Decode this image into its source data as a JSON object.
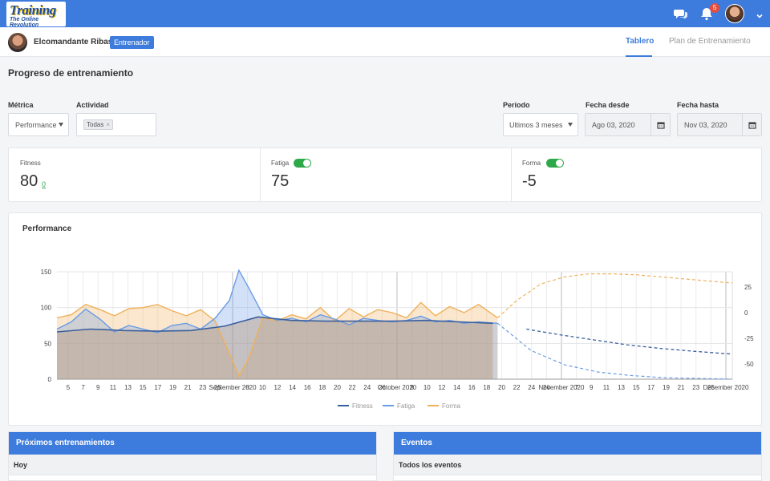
{
  "topbar": {
    "logo_line1": "Training",
    "logo_line2": "The Online Revolution",
    "notifications_count": "5"
  },
  "subbar": {
    "user_name": "Elcomandante Ribas",
    "role": "Entrenador",
    "tabs": [
      {
        "label": "Tablero",
        "active": true
      },
      {
        "label": "Plan de Entrenamiento",
        "active": false
      }
    ]
  },
  "page": {
    "title": "Progreso de entrenamiento"
  },
  "filters": {
    "metric": {
      "label": "Métrica",
      "value": "Performance"
    },
    "activity": {
      "label": "Actividad",
      "tag": "Todas",
      "tag_remove": "×"
    },
    "period": {
      "label": "Período",
      "value": "Ultimos 3 meses"
    },
    "date_from": {
      "label": "Fecha desde",
      "value": "Ago 03, 2020"
    },
    "date_to": {
      "label": "Fecha hasta",
      "value": "Nov 03, 2020"
    }
  },
  "summary": {
    "fitness": {
      "label": "Fitness",
      "value": "80",
      "delta": "0"
    },
    "fatigue": {
      "label": "Fatiga",
      "value": "75",
      "toggle_on": true
    },
    "form": {
      "label": "Forma",
      "value": "-5",
      "toggle_on": true
    }
  },
  "chart_data": {
    "type": "line",
    "title": "Performance",
    "x_range": [
      "2020-08-03",
      "2020-12-22"
    ],
    "ylim_left": [
      0,
      150
    ],
    "yticks_left": [
      0,
      50,
      100,
      150
    ],
    "ylim_right": [
      -65,
      40
    ],
    "yticks_right": [
      -50,
      -25,
      0,
      25
    ],
    "xticks": [
      "5",
      "7",
      "9",
      "11",
      "13",
      "15",
      "17",
      "19",
      "21",
      "23",
      "25",
      "September 2020",
      "8",
      "10",
      "12",
      "14",
      "16",
      "18",
      "20",
      "22",
      "24",
      "26",
      "October 2020",
      "8",
      "10",
      "12",
      "14",
      "16",
      "18",
      "20",
      "22",
      "24",
      "26",
      "November 2020",
      "7",
      "9",
      "11",
      "13",
      "15",
      "17",
      "19",
      "21",
      "23",
      "25",
      "December 2020"
    ],
    "grid": true,
    "legend_position": "bottom",
    "colors": {
      "fitness": "#3a5f9e",
      "fatigue": "#6b9be6",
      "form": "#f0b05a"
    },
    "series": [
      {
        "name": "Fitness",
        "axis": "left",
        "x": [
          "2020-08-03",
          "2020-08-10",
          "2020-08-17",
          "2020-08-24",
          "2020-08-31",
          "2020-09-07",
          "2020-09-14",
          "2020-09-21",
          "2020-09-28",
          "2020-10-05",
          "2020-10-12",
          "2020-10-19",
          "2020-10-26",
          "2020-11-02",
          "2020-11-09",
          "2020-11-16",
          "2020-11-23",
          "2020-11-30",
          "2020-12-07",
          "2020-12-14",
          "2020-12-22"
        ],
        "values": [
          66,
          70,
          68,
          67,
          68,
          74,
          87,
          82,
          81,
          81,
          81,
          82,
          80,
          78,
          70,
          62,
          55,
          48,
          43,
          39,
          35
        ]
      },
      {
        "name": "Fatiga",
        "axis": "left",
        "x": [
          "2020-08-03",
          "2020-08-06",
          "2020-08-09",
          "2020-08-12",
          "2020-08-15",
          "2020-08-18",
          "2020-08-21",
          "2020-08-24",
          "2020-08-27",
          "2020-08-30",
          "2020-09-02",
          "2020-09-05",
          "2020-09-08",
          "2020-09-10",
          "2020-09-12",
          "2020-09-15",
          "2020-09-18",
          "2020-09-21",
          "2020-09-24",
          "2020-09-27",
          "2020-09-30",
          "2020-10-03",
          "2020-10-06",
          "2020-10-09",
          "2020-10-12",
          "2020-10-15",
          "2020-10-18",
          "2020-10-21",
          "2020-10-24",
          "2020-10-27",
          "2020-10-30",
          "2020-11-03",
          "2020-11-10",
          "2020-11-17",
          "2020-11-24",
          "2020-12-01",
          "2020-12-08",
          "2020-12-15",
          "2020-12-22"
        ],
        "values": [
          70,
          80,
          98,
          84,
          66,
          75,
          70,
          65,
          75,
          78,
          70,
          85,
          110,
          152,
          128,
          90,
          82,
          85,
          80,
          90,
          84,
          76,
          85,
          82,
          80,
          82,
          88,
          80,
          82,
          78,
          80,
          78,
          40,
          20,
          10,
          5,
          2,
          1,
          0
        ]
      },
      {
        "name": "Forma",
        "axis": "right",
        "x": [
          "2020-08-03",
          "2020-08-06",
          "2020-08-09",
          "2020-08-12",
          "2020-08-15",
          "2020-08-18",
          "2020-08-21",
          "2020-08-24",
          "2020-08-27",
          "2020-08-30",
          "2020-09-02",
          "2020-09-05",
          "2020-09-08",
          "2020-09-10",
          "2020-09-12",
          "2020-09-15",
          "2020-09-18",
          "2020-09-21",
          "2020-09-24",
          "2020-09-27",
          "2020-09-30",
          "2020-10-03",
          "2020-10-06",
          "2020-10-09",
          "2020-10-12",
          "2020-10-15",
          "2020-10-18",
          "2020-10-21",
          "2020-10-24",
          "2020-10-27",
          "2020-10-30",
          "2020-11-03",
          "2020-11-07",
          "2020-11-12",
          "2020-11-17",
          "2020-11-22",
          "2020-11-27",
          "2020-12-02",
          "2020-12-07",
          "2020-12-12",
          "2020-12-17",
          "2020-12-22"
        ],
        "values": [
          -5,
          -2,
          8,
          3,
          -3,
          4,
          5,
          8,
          2,
          -3,
          3,
          -8,
          -40,
          -62,
          -45,
          -5,
          -8,
          -2,
          -6,
          5,
          -8,
          4,
          -4,
          3,
          0,
          -5,
          10,
          -3,
          6,
          0,
          8,
          -5,
          12,
          28,
          35,
          38,
          38,
          37,
          35,
          33,
          31,
          29
        ]
      }
    ]
  },
  "panels": {
    "upcoming": {
      "title": "Próximos entrenamientos",
      "subheader": "Hoy"
    },
    "events": {
      "title": "Eventos",
      "subheader": "Todos los eventos"
    }
  }
}
